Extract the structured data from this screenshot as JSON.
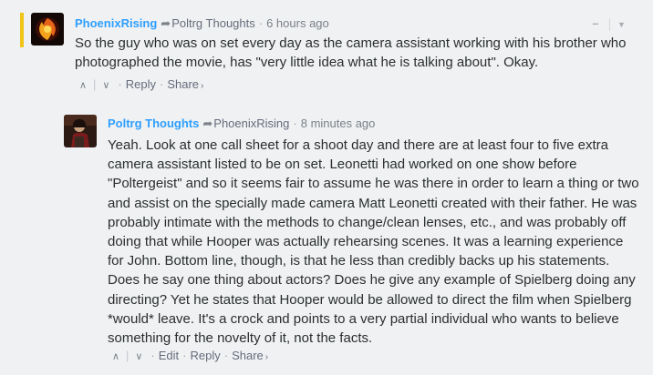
{
  "comments": [
    {
      "author": "PhoenixRising",
      "reply_to": "Poltrg Thoughts",
      "timestamp": "6 hours ago",
      "body": "So the guy who was on set every day as the camera assistant working with his brother who photographed the movie, has \"very little idea what he is talking about\". Okay.",
      "actions": {
        "reply": "Reply",
        "share": "Share"
      },
      "controls": {
        "collapse": "–"
      },
      "accent_color": "#f0c419"
    },
    {
      "author": "Poltrg Thoughts",
      "reply_to": "PhoenixRising",
      "timestamp": "8 minutes ago",
      "body": "Yeah. Look at one call sheet for a shoot day and there are at least four to five extra camera assistant listed to be on set. Leonetti had worked on one show before \"Poltergeist\" and so it seems fair to assume he was there in order to learn a thing or two and assist on the specially made camera Matt Leonetti created with their father. He was probably intimate with the methods to change/clean lenses, etc., and was probably off doing that while Hooper was actually rehearsing scenes. It was a learning experience for John. Bottom line, though, is that he less than credibly backs up his statements. Does he say one thing about actors? Does he give any example of Spielberg doing any directing? Yet he states that Hooper would be allowed to direct the film when Spielberg *would* leave. It's a crock and points to a very partial individual who wants to believe something for the novelty of it, not the facts.",
      "actions": {
        "edit": "Edit",
        "reply": "Reply",
        "share": "Share"
      }
    }
  ],
  "theme": {
    "link_color": "#2e9fff",
    "text_color": "#2a2e2e",
    "meta_color": "#656c7a",
    "background": "#f0f1f3"
  }
}
